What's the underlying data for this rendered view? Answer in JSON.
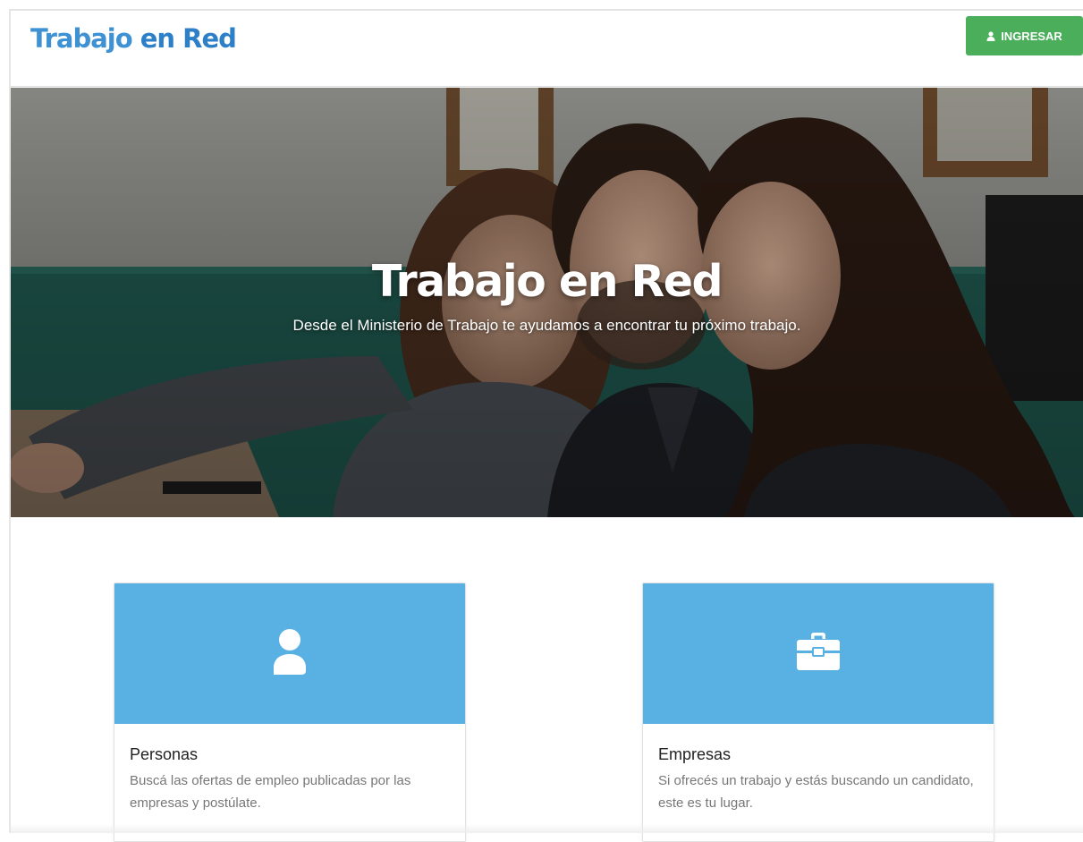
{
  "header": {
    "brand_part1": "Trabajo ",
    "brand_part2": "en Red",
    "login_label": "INGRESAR",
    "login_icon": "user-icon"
  },
  "hero": {
    "title": "Trabajo en Red",
    "subtitle": "Desde el Ministerio de Trabajo te ayudamos a encontrar tu próximo trabajo."
  },
  "cards": [
    {
      "icon": "person-icon",
      "title": "Personas",
      "text": "Buscá las ofertas de empleo publicadas por las empresas y postúlate."
    },
    {
      "icon": "briefcase-icon",
      "title": "Empresas",
      "text": "Si ofrecés un trabajo y estás buscando un candidato, este es tu lugar."
    }
  ],
  "colors": {
    "brand_blue": "#3e91d3",
    "login_green": "#4bae5b",
    "card_blue": "#58b0e3"
  }
}
